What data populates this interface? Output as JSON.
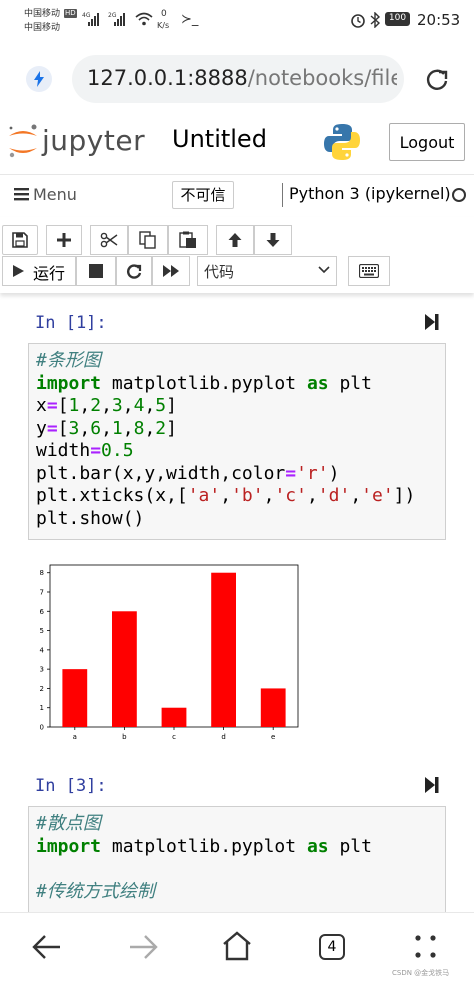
{
  "status_bar": {
    "carrier1": "中国移动",
    "carrier2": "中国移动",
    "hd": "HD",
    "net1": "4G",
    "net2": "2G",
    "speed": "0",
    "speed_unit": "K/s",
    "battery": "100",
    "time": "20:53"
  },
  "browser": {
    "url_host": "127.0.0.1:8888",
    "url_path": "/notebooks/file/U",
    "tab_count": "4"
  },
  "jupyter": {
    "wordmark": "jupyter",
    "notebook_title": "Untitled",
    "logout_label": "Logout",
    "menu_label": "Menu",
    "trust_label": "不可信",
    "kernel_name": "Python 3 (ipykernel)"
  },
  "toolbar": {
    "run_label": "运行",
    "cell_type": "代码"
  },
  "cells": [
    {
      "prompt": "In [1]:",
      "lines": [
        [
          {
            "t": "#条形图",
            "c": "cm"
          }
        ],
        [
          {
            "t": "import",
            "c": "kw"
          },
          {
            "t": " matplotlib.pyplot "
          },
          {
            "t": "as",
            "c": "kw"
          },
          {
            "t": " plt"
          }
        ],
        [
          {
            "t": "x"
          },
          {
            "t": "=",
            "c": "op"
          },
          {
            "t": "["
          },
          {
            "t": "1",
            "c": "nm"
          },
          {
            "t": ","
          },
          {
            "t": "2",
            "c": "nm"
          },
          {
            "t": ","
          },
          {
            "t": "3",
            "c": "nm"
          },
          {
            "t": ","
          },
          {
            "t": "4",
            "c": "nm"
          },
          {
            "t": ","
          },
          {
            "t": "5",
            "c": "nm"
          },
          {
            "t": "]"
          }
        ],
        [
          {
            "t": "y"
          },
          {
            "t": "=",
            "c": "op"
          },
          {
            "t": "["
          },
          {
            "t": "3",
            "c": "nm"
          },
          {
            "t": ","
          },
          {
            "t": "6",
            "c": "nm"
          },
          {
            "t": ","
          },
          {
            "t": "1",
            "c": "nm"
          },
          {
            "t": ","
          },
          {
            "t": "8",
            "c": "nm"
          },
          {
            "t": ","
          },
          {
            "t": "2",
            "c": "nm"
          },
          {
            "t": "]"
          }
        ],
        [
          {
            "t": "width"
          },
          {
            "t": "=",
            "c": "op"
          },
          {
            "t": "0.5",
            "c": "nm"
          }
        ],
        [
          {
            "t": "plt.bar(x,y,width,color"
          },
          {
            "t": "=",
            "c": "op"
          },
          {
            "t": "'r'",
            "c": "st"
          },
          {
            "t": ")"
          }
        ],
        [
          {
            "t": "plt.xticks(x,["
          },
          {
            "t": "'a'",
            "c": "st"
          },
          {
            "t": ","
          },
          {
            "t": "'b'",
            "c": "st"
          },
          {
            "t": ","
          },
          {
            "t": "'c'",
            "c": "st"
          },
          {
            "t": ","
          },
          {
            "t": "'d'",
            "c": "st"
          },
          {
            "t": ","
          },
          {
            "t": "'e'",
            "c": "st"
          },
          {
            "t": "])"
          }
        ],
        [
          {
            "t": "plt.show()"
          }
        ]
      ]
    },
    {
      "prompt": "In [3]:",
      "lines": [
        [
          {
            "t": "#散点图",
            "c": "cm"
          }
        ],
        [
          {
            "t": "import",
            "c": "kw"
          },
          {
            "t": " matplotlib.pyplot "
          },
          {
            "t": "as",
            "c": "kw"
          },
          {
            "t": " plt"
          }
        ],
        [
          {
            "t": ""
          }
        ],
        [
          {
            "t": "#传统方式绘制",
            "c": "cm"
          }
        ]
      ]
    }
  ],
  "chart_data": {
    "type": "bar",
    "categories": [
      "a",
      "b",
      "c",
      "d",
      "e"
    ],
    "values": [
      3,
      6,
      1,
      8,
      2
    ],
    "bar_color": "#ff0000",
    "ylim": [
      0,
      8.4
    ],
    "yticks": [
      0,
      1,
      2,
      3,
      4,
      5,
      6,
      7,
      8
    ]
  },
  "footer": {
    "watermark": "CSDN @金戈铁马"
  },
  "colors": {
    "prompt_blue": "#303f9f",
    "jupyter_orange": "#f37726"
  }
}
